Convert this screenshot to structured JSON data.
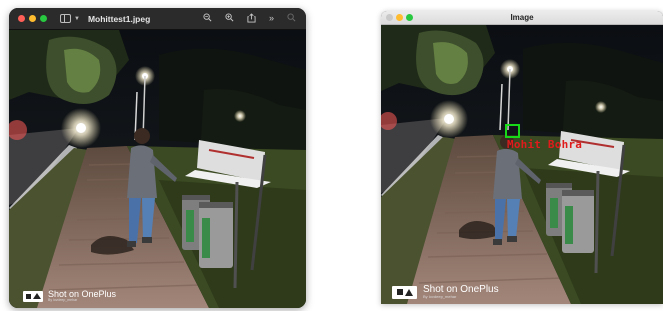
{
  "left_window": {
    "title": "Mohittest1.jpeg",
    "toolbar_icons": [
      "sidebar-icon",
      "zoom-out-icon",
      "zoom-in-icon",
      "share-icon",
      "more-icon",
      "search-icon"
    ],
    "photo_watermark": {
      "main": "Shot on OnePlus",
      "sub": "By lovdeep_mehar"
    }
  },
  "right_window": {
    "title": "Image",
    "photo_watermark": {
      "main": "Shot on OnePlus",
      "sub": "By lovdeep_mehar"
    },
    "detection_label": "Mohit Bohra"
  },
  "colors": {
    "close": "#ff5f57",
    "minimize": "#febc2e",
    "zoom": "#28c840",
    "detection_box": "#18d918",
    "detection_text": "#e01b1b"
  }
}
